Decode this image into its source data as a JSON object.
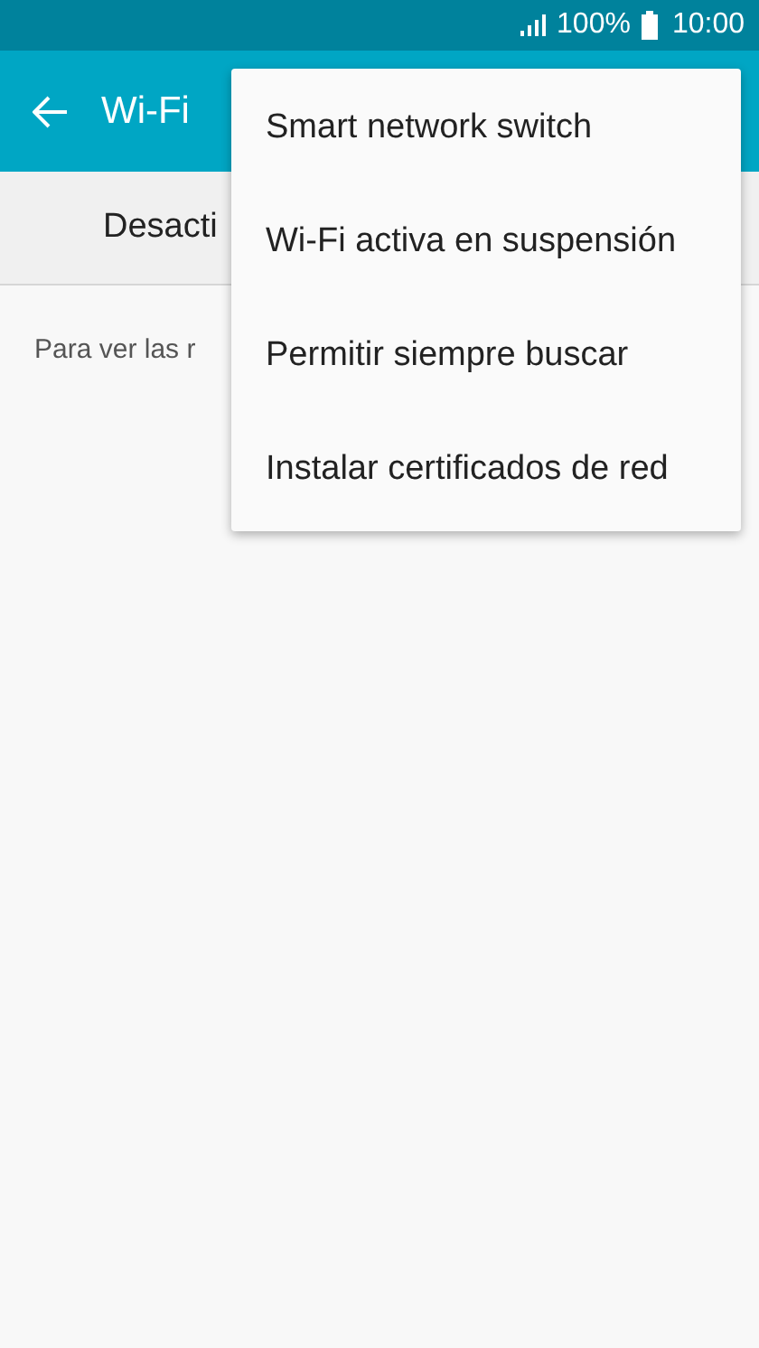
{
  "status_bar": {
    "battery_text": "100%",
    "time": "10:00"
  },
  "app_bar": {
    "title": "Wi-Fi"
  },
  "switch_bar": {
    "label": "Desacti"
  },
  "body": {
    "text": "Para ver las r"
  },
  "menu": {
    "items": [
      "Smart network switch",
      "Wi-Fi activa en suspensión",
      "Permitir siempre buscar",
      "Instalar certificados de red"
    ]
  }
}
